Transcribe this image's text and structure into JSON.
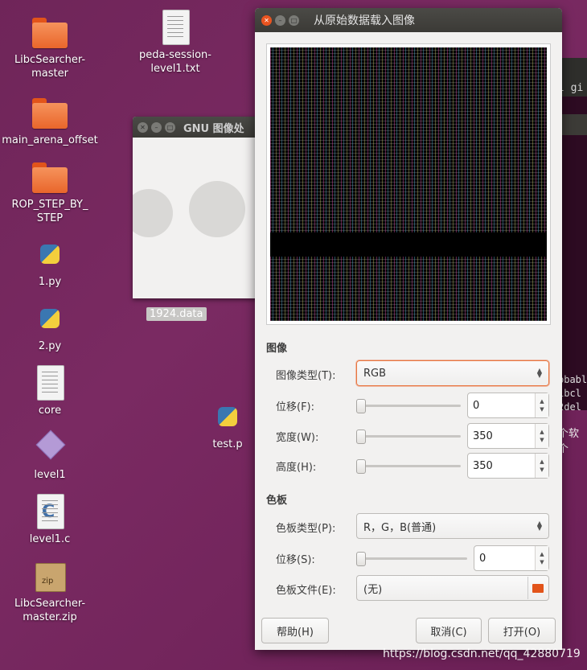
{
  "desktop": {
    "icons": [
      {
        "label": "LibcSearcher-\nmaster",
        "type": "folder-icon"
      },
      {
        "label": "main_arena_offset",
        "type": "folder-icon"
      },
      {
        "label": "ROP_STEP_BY_\nSTEP",
        "type": "folder-icon"
      },
      {
        "label": "1.py",
        "type": "python-icon"
      },
      {
        "label": "2.py",
        "type": "python-icon"
      },
      {
        "label": "core",
        "type": "document-icon"
      },
      {
        "label": "level1",
        "type": "executable-icon"
      },
      {
        "label": "level1.c",
        "type": "c-source-icon"
      },
      {
        "label": "LibcSearcher-\nmaster.zip",
        "type": "zip-icon"
      },
      {
        "label": "peda-session-\nlevel1.txt",
        "type": "document-icon"
      },
      {
        "label": "test.p",
        "type": "python-icon"
      }
    ],
    "selected_file": "1924.data"
  },
  "background_window": {
    "title": "GNU 图像处"
  },
  "terminal": {
    "line_top": "l gi",
    "lines": "obabl\nibcl\n2del",
    "text_cn": "个软个"
  },
  "dialog": {
    "title": "从原始数据载入图像",
    "image_section": {
      "heading": "图像",
      "image_type_label": "图像类型(T):",
      "image_type_value": "RGB",
      "offset_label": "位移(F):",
      "offset_value": "0",
      "width_label": "宽度(W):",
      "width_value": "350",
      "height_label": "高度(H):",
      "height_value": "350"
    },
    "palette_section": {
      "heading": "色板",
      "palette_type_label": "色板类型(P):",
      "palette_type_value": "R，G，B(普通)",
      "offset_label": "位移(S):",
      "offset_value": "0",
      "file_label": "色板文件(E):",
      "file_value": "(无)"
    },
    "buttons": {
      "help": "帮助(H)",
      "cancel": "取消(C)",
      "open": "打开(O)"
    }
  },
  "watermark": "https://blog.csdn.net/qq_42880719",
  "colors": {
    "accent": "#e95420",
    "folder": "#f0783c",
    "titlebar": "#3c3b37"
  }
}
